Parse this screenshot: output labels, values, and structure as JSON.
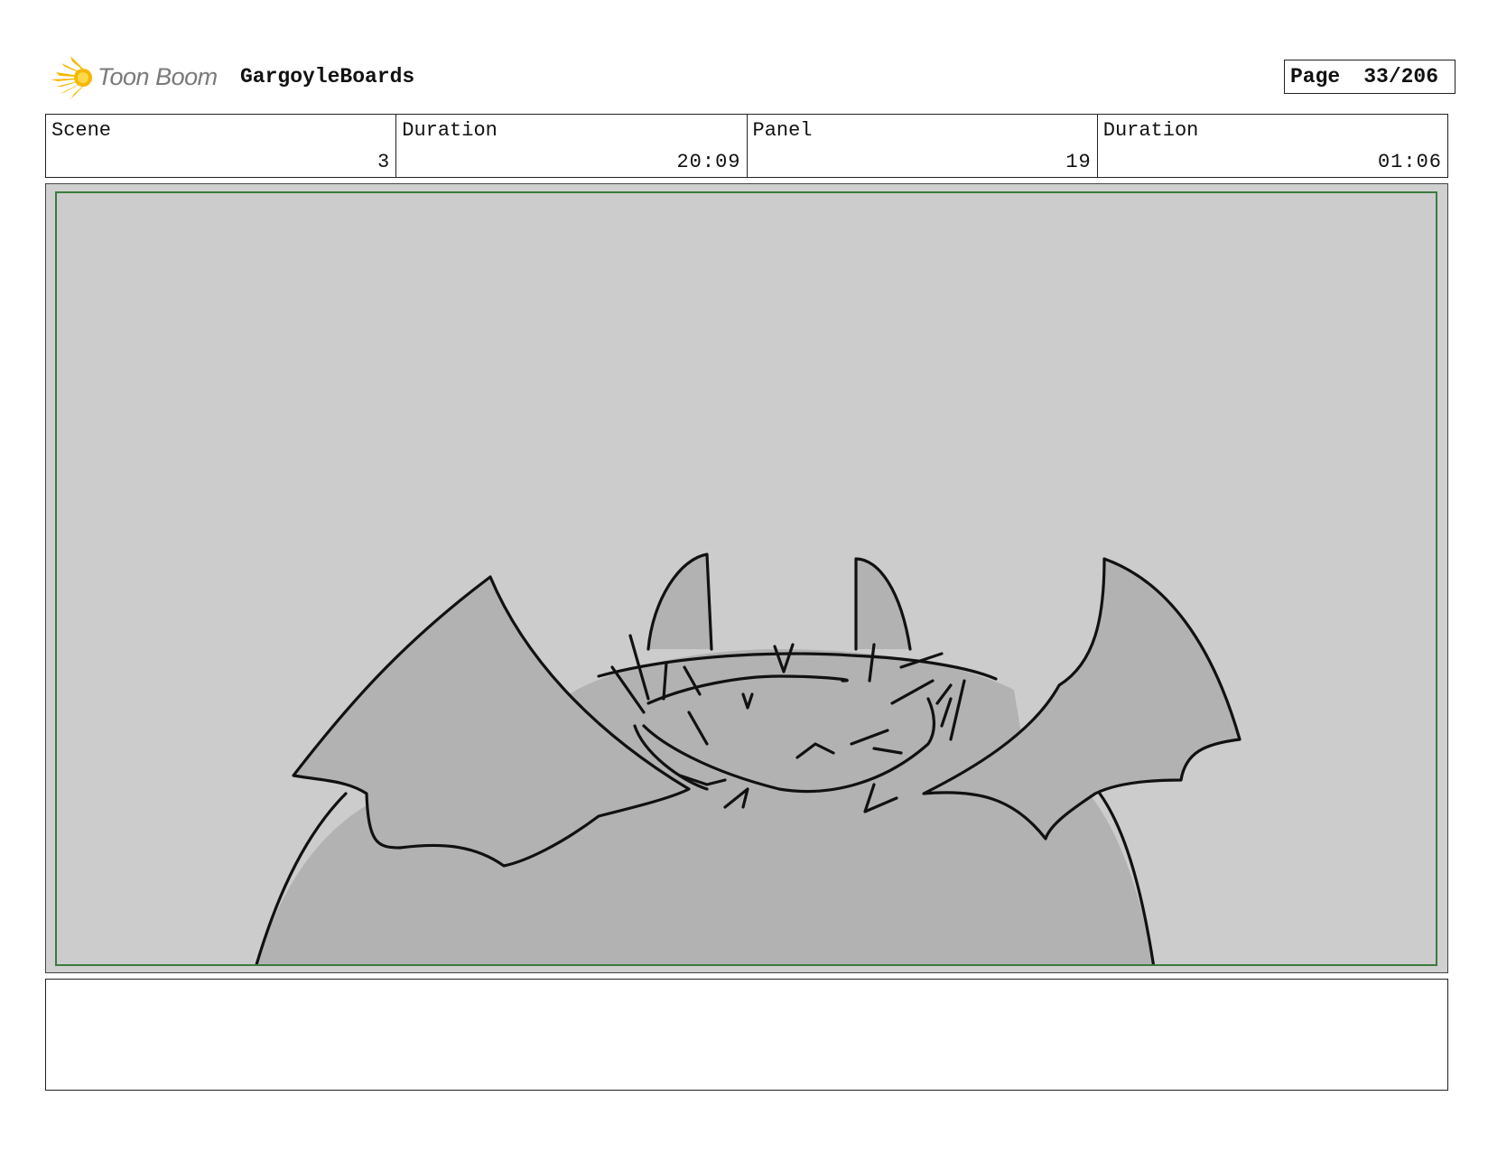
{
  "header": {
    "logo_text": "Toon Boom",
    "project_title": "GargoyleBoards",
    "page_label": "Page",
    "page_value": "33/206"
  },
  "info": [
    {
      "label": "Scene",
      "value": "3"
    },
    {
      "label": "Duration",
      "value": "20:09"
    },
    {
      "label": "Panel",
      "value": "19"
    },
    {
      "label": "Duration",
      "value": "01:06"
    }
  ],
  "notes": {
    "text": ""
  },
  "colors": {
    "logo_accent": "#f5b800",
    "frame_border": "#3c7a3c",
    "panel_bg": "#cccccc",
    "character_fill": "#b2b2b2"
  }
}
